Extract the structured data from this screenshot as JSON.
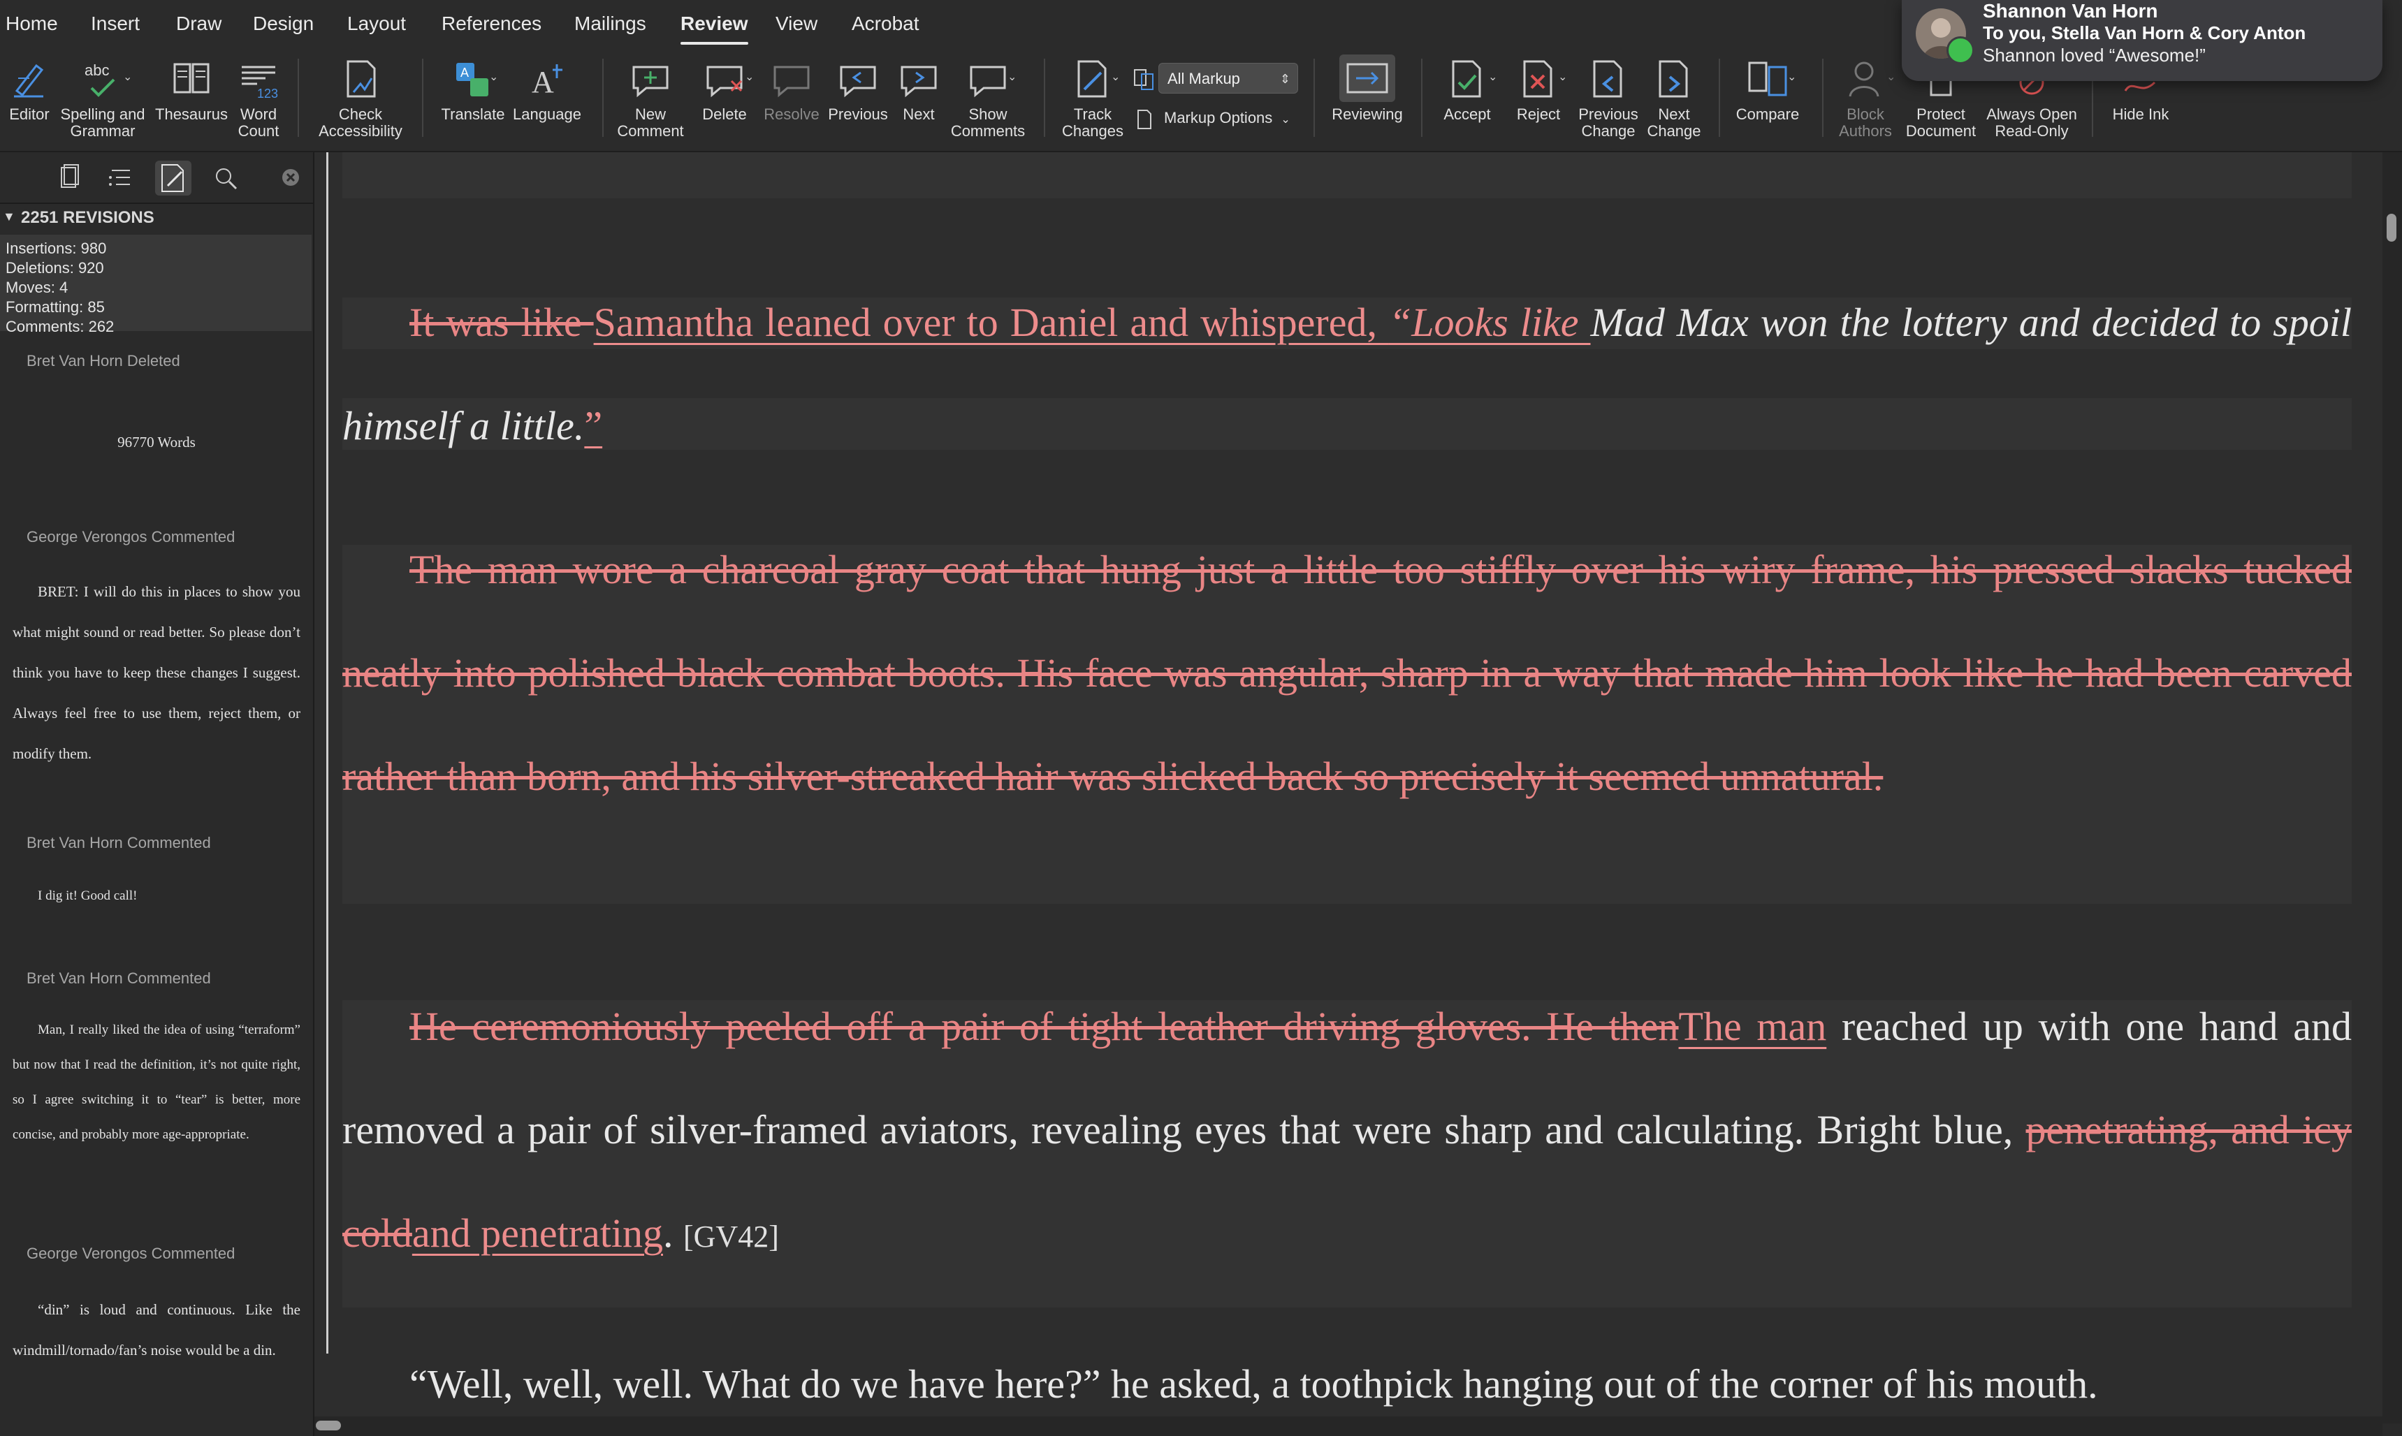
{
  "tabs": [
    {
      "label": "Home"
    },
    {
      "label": "Insert"
    },
    {
      "label": "Draw"
    },
    {
      "label": "Design"
    },
    {
      "label": "Layout"
    },
    {
      "label": "References"
    },
    {
      "label": "Mailings"
    },
    {
      "label": "Review"
    },
    {
      "label": "View"
    },
    {
      "label": "Acrobat"
    }
  ],
  "active_tab": "Review",
  "ribbon": {
    "editor": [
      "Editor"
    ],
    "spelling": [
      "Spelling and",
      "Grammar"
    ],
    "thesaurus": [
      "Thesaurus"
    ],
    "word_count": [
      "Word",
      "Count"
    ],
    "check_accessibility": [
      "Check",
      "Accessibility"
    ],
    "translate": [
      "Translate"
    ],
    "language": [
      "Language"
    ],
    "new_comment": [
      "New",
      "Comment"
    ],
    "delete": [
      "Delete"
    ],
    "resolve": [
      "Resolve"
    ],
    "previous": [
      "Previous"
    ],
    "next": [
      "Next"
    ],
    "show_comments": [
      "Show",
      "Comments"
    ],
    "track_changes": [
      "Track",
      "Changes"
    ],
    "markup_select": "All Markup",
    "markup_options": "Markup Options",
    "reviewing": [
      "Reviewing"
    ],
    "accept": [
      "Accept"
    ],
    "reject": [
      "Reject"
    ],
    "previous_change": [
      "Previous",
      "Change"
    ],
    "next_change": [
      "Next",
      "Change"
    ],
    "compare": [
      "Compare"
    ],
    "block_authors": [
      "Block",
      "Authors"
    ],
    "protect_document": [
      "Protect",
      "Document"
    ],
    "always_open_read_only": [
      "Always Open",
      "Read-Only"
    ],
    "hide_ink": [
      "Hide Ink"
    ]
  },
  "notification": {
    "title": "Shannon Van Horn",
    "subtitle": "To you, Stella Van Horn & Cory Anton",
    "body": "Shannon loved “Awesome!”"
  },
  "revisions": {
    "header": "2251 REVISIONS",
    "stats": [
      "Insertions: 980",
      "Deletions: 920",
      "Moves: 4",
      "Formatting: 85",
      "Comments: 262"
    ],
    "items": [
      {
        "author": "Bret Van Horn Deleted",
        "text": "96770 Words"
      },
      {
        "author": "George Verongos Commented",
        "text": "BRET: I will do this in places to show you what might sound or read better. So please don’t think you have to keep these changes I suggest. Always feel free to use them, reject them,  or modify them."
      },
      {
        "author": "Bret Van Horn Commented",
        "text": "I dig it! Good call!"
      },
      {
        "author": "Bret Van Horn Commented",
        "text": "Man, I really liked the idea of using “terraform” but now that I read the definition, it’s not quite right, so I agree switching it to “tear” is better, more concise, and probably more age-appropriate."
      },
      {
        "author": "George Verongos Commented",
        "text": "“din” is loud and continuous. Like the windmill/tornado/fan’s noise would be a din."
      }
    ]
  },
  "document": {
    "p1": {
      "del1": "It was like ",
      "ins1": "Samantha leaned over to Daniel and whispered, ",
      "ins1_ital": "“Looks like ",
      "ital": "Mad Max won the lottery and decided to spoil himself a little.",
      "ins2": "”"
    },
    "p2": {
      "del": "The man wore a charcoal gray coat that hung just a little too stiffly over his wiry frame, his pressed slacks tucked neatly into polished black combat boots. His face was angular, sharp in a way that made him look like he had been carved rather than born, and his silver-streaked hair was slicked back so precisely it seemed unnatural."
    },
    "p3": {
      "del1": "He ceremoniously peeled off a pair of tight leather driving gloves. He then",
      "ins1": "The man",
      "plain1": " reached up with one hand and removed a pair of silver-framed aviators, revealing eyes that were sharp and calculating. Bright blue, ",
      "del2": "penetrating, and icy cold",
      "ins2": "and penetrating",
      "plain2": ". ",
      "ref": "[GV42]"
    },
    "p4": {
      "plain": "“Well, well, well. What do we have here?” he asked, a toothpick hanging out of the corner of his mouth."
    }
  }
}
